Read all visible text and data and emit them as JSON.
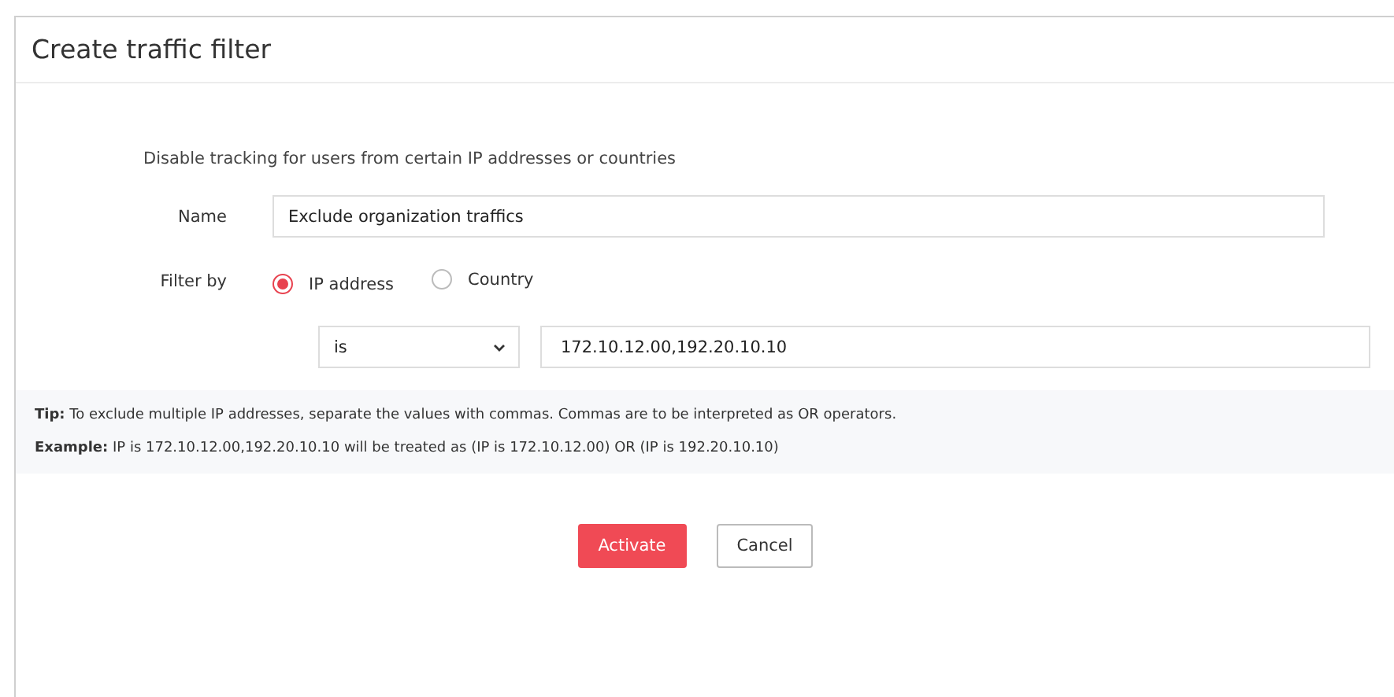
{
  "window": {
    "title": "Create traffic filter"
  },
  "description": "Disable tracking for users from certain IP addresses or countries",
  "name_field": {
    "label": "Name",
    "value": "Exclude organization traffics"
  },
  "filter_by": {
    "label": "Filter by",
    "options": [
      {
        "label": "IP address",
        "selected": true
      },
      {
        "label": "Country",
        "selected": false
      }
    ]
  },
  "condition": {
    "operator": "is",
    "value": "172.10.12.00,192.20.10.10"
  },
  "notes": [
    "**Tip:** To exclude multiple IP addresses, separate the values with commas. Commas are to be interpreted as OR operators.",
    "**Example:** IP is 172.10.12.00,192.20.10.10 will be treated as (IP is 172.10.12.00) OR (IP is 192.20.10.10)"
  ],
  "buttons": [
    {
      "label": "Activate",
      "kind": "primary"
    },
    {
      "label": "Cancel",
      "kind": "secondary"
    }
  ]
}
